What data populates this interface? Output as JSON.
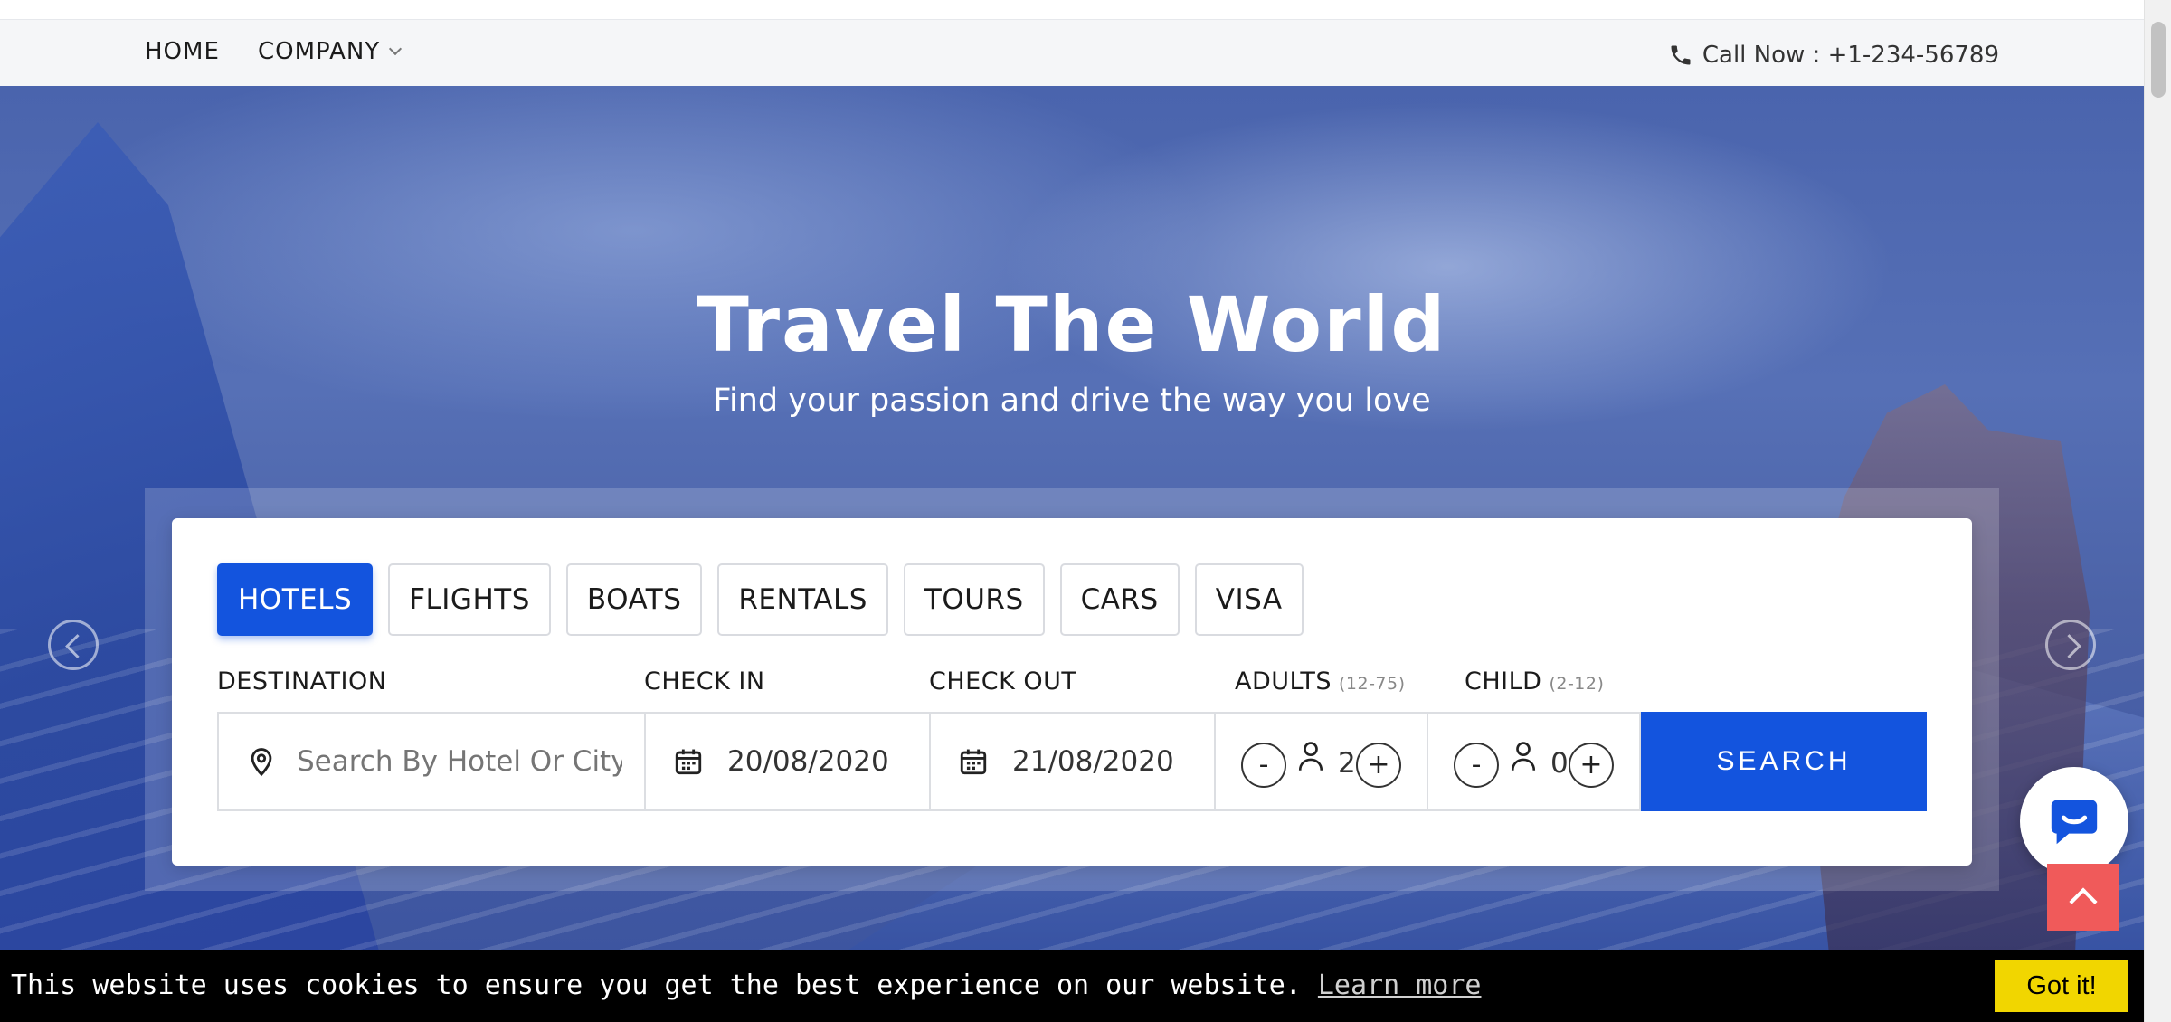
{
  "nav": {
    "home": "HOME",
    "company": "COMPANY",
    "phone": "Call Now : +1-234-56789"
  },
  "hero": {
    "title": "Travel The World",
    "subtitle": "Find your passion and drive the way you love"
  },
  "search": {
    "tabs": [
      "HOTELS",
      "FLIGHTS",
      "BOATS",
      "RENTALS",
      "TOURS",
      "CARS",
      "VISA"
    ],
    "active_tab": "HOTELS",
    "labels": {
      "destination": "DESTINATION",
      "check_in": "CHECK IN",
      "check_out": "CHECK OUT",
      "adults": "ADULTS",
      "adults_range": "(12-75)",
      "child": "CHILD",
      "child_range": "(2-12)"
    },
    "destination_placeholder": "Search By Hotel Or City Name",
    "check_in": "20/08/2020",
    "check_out": "21/08/2020",
    "adults": "2",
    "child": "0",
    "minus": "-",
    "plus": "+",
    "button": "SEARCH"
  },
  "cookie": {
    "message": "This website uses cookies to ensure you get the best experience on our website.",
    "learn_more": "Learn more",
    "button": "Got it!"
  },
  "colors": {
    "accent": "#1354de",
    "cookie_button": "#f1d600",
    "to_top": "#f05a5a"
  }
}
